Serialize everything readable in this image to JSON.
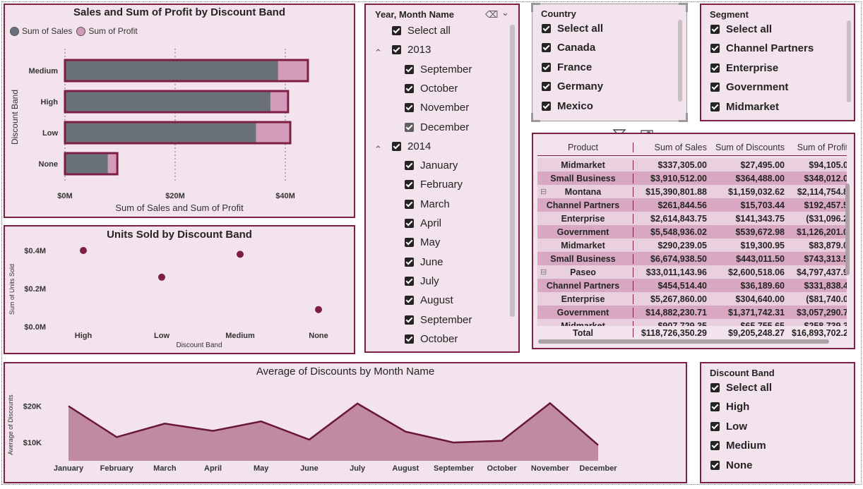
{
  "colors": {
    "accent": "#7d1f45",
    "panel_bg": "#f3e3ec",
    "sales_bar": "#6a717b",
    "profit_bar": "#d49ab9",
    "area_fill": "#bf8aa2",
    "row_band": "#d8a8c3"
  },
  "sales_profit_chart": {
    "title": "Sales and Sum of Profit by Discount Band",
    "legend": [
      {
        "label": "Sum of Sales",
        "color": "#6a717b"
      },
      {
        "label": "Sum of  Profit",
        "color": "#d49ab9"
      }
    ],
    "xlabel": "Sum of Sales and Sum of Profit",
    "ylabel": "Discount Band",
    "chart_data": {
      "type": "bar",
      "orientation": "horizontal",
      "stacked": true,
      "categories": [
        "Medium",
        "High",
        "Low",
        "None"
      ],
      "series": [
        {
          "name": "Sum of Sales",
          "values": [
            38.7,
            37.3,
            34.7,
            7.8
          ]
        },
        {
          "name": "Sum of  Profit",
          "values": [
            5.4,
            3.2,
            6.2,
            1.7
          ]
        }
      ],
      "xticks": [
        "$0M",
        "$20M",
        "$40M"
      ],
      "xtick_values": [
        0,
        20,
        40
      ],
      "xlim": [
        0,
        46
      ],
      "xlabel": "Sum of Sales and Sum of Profit",
      "ylabel": "Discount Band",
      "legend": "top-left"
    }
  },
  "units_chart": {
    "title": "Units Sold by Discount Band",
    "xlabel": "Discount Band",
    "ylabel": "Sum of Units Sold",
    "chart_data": {
      "type": "scatter",
      "categories": [
        "High",
        "Low",
        "Medium",
        "None"
      ],
      "values": [
        0.4,
        0.26,
        0.38,
        0.09
      ],
      "yticks": [
        "$0.0M",
        "$0.2M",
        "$0.4M"
      ],
      "ytick_values": [
        0,
        0.2,
        0.4
      ],
      "ylim": [
        0,
        0.4
      ]
    }
  },
  "year_month_slicer": {
    "title": "Year, Month Name",
    "items": [
      {
        "label": "Select all",
        "level": 0,
        "check": "on"
      },
      {
        "label": "2013",
        "level": 0,
        "check": "on",
        "expand": "⌃"
      },
      {
        "label": "September",
        "level": 1,
        "check": "on"
      },
      {
        "label": "October",
        "level": 1,
        "check": "on"
      },
      {
        "label": "November",
        "level": 1,
        "check": "on"
      },
      {
        "label": "December",
        "level": 1,
        "check": "partial"
      },
      {
        "label": "2014",
        "level": 0,
        "check": "on",
        "expand": "⌃"
      },
      {
        "label": "January",
        "level": 1,
        "check": "on"
      },
      {
        "label": "February",
        "level": 1,
        "check": "on"
      },
      {
        "label": "March",
        "level": 1,
        "check": "on"
      },
      {
        "label": "April",
        "level": 1,
        "check": "on"
      },
      {
        "label": "May",
        "level": 1,
        "check": "on"
      },
      {
        "label": "June",
        "level": 1,
        "check": "on"
      },
      {
        "label": "July",
        "level": 1,
        "check": "on"
      },
      {
        "label": "August",
        "level": 1,
        "check": "on"
      },
      {
        "label": "September",
        "level": 1,
        "check": "on"
      },
      {
        "label": "October",
        "level": 1,
        "check": "on"
      }
    ]
  },
  "country_slicer": {
    "title": "Country",
    "items": [
      "Select all",
      "Canada",
      "France",
      "Germany",
      "Mexico"
    ]
  },
  "segment_slicer": {
    "title": "Segment",
    "items": [
      "Select all",
      "Channel Partners",
      "Enterprise",
      "Government",
      "Midmarket"
    ]
  },
  "discount_slicer": {
    "title": "Discount Band",
    "items": [
      "Select all",
      "High",
      "Low",
      "Medium",
      "None"
    ]
  },
  "table": {
    "columns": [
      "Product",
      "Sum of Sales",
      "Sum of Discounts",
      "Sum of Profit"
    ],
    "rows": [
      {
        "label": "Midmarket",
        "sales": "$337,305.00",
        "discounts": "$27,495.00",
        "profit": "$94,105.0",
        "group": false,
        "band": false
      },
      {
        "label": "Small Business",
        "sales": "$3,910,512.00",
        "discounts": "$364,488.00",
        "profit": "$348,012.0",
        "group": false,
        "band": true
      },
      {
        "label": "Montana",
        "sales": "$15,390,801.88",
        "discounts": "$1,159,032.62",
        "profit": "$2,114,754.8",
        "group": true,
        "band": false
      },
      {
        "label": "Channel Partners",
        "sales": "$261,844.56",
        "discounts": "$15,703.44",
        "profit": "$192,457.5",
        "group": false,
        "band": true
      },
      {
        "label": "Enterprise",
        "sales": "$2,614,843.75",
        "discounts": "$141,343.75",
        "profit": "($31,096.2",
        "group": false,
        "band": false
      },
      {
        "label": "Government",
        "sales": "$5,548,936.02",
        "discounts": "$539,672.98",
        "profit": "$1,126,201.0",
        "group": false,
        "band": true
      },
      {
        "label": "Midmarket",
        "sales": "$290,239.05",
        "discounts": "$19,300.95",
        "profit": "$83,879.0",
        "group": false,
        "band": false
      },
      {
        "label": "Small Business",
        "sales": "$6,674,938.50",
        "discounts": "$443,011.50",
        "profit": "$743,313.5",
        "group": false,
        "band": true
      },
      {
        "label": "Paseo",
        "sales": "$33,011,143.96",
        "discounts": "$2,600,518.06",
        "profit": "$4,797,437.9",
        "group": true,
        "band": false
      },
      {
        "label": "Channel Partners",
        "sales": "$454,514.40",
        "discounts": "$36,189.60",
        "profit": "$331,838.4",
        "group": false,
        "band": true
      },
      {
        "label": "Enterprise",
        "sales": "$5,267,860.00",
        "discounts": "$304,640.00",
        "profit": "($81,740.0",
        "group": false,
        "band": false
      },
      {
        "label": "Government",
        "sales": "$14,882,230.71",
        "discounts": "$1,371,742.31",
        "profit": "$3,057,290.7",
        "group": false,
        "band": true
      },
      {
        "label": "Midmarket",
        "sales": "$907,729.35",
        "discounts": "$65,755.65",
        "profit": "$258,739.3",
        "group": false,
        "band": false
      }
    ],
    "total": {
      "label": "Total",
      "sales": "$118,726,350.29",
      "discounts": "$9,205,248.27",
      "profit": "$16,893,702.2"
    }
  },
  "area_chart": {
    "title": "Average of Discounts by Month Name",
    "ylabel": "Average of Discounts",
    "chart_data": {
      "type": "area",
      "categories": [
        "January",
        "February",
        "March",
        "April",
        "May",
        "June",
        "July",
        "August",
        "September",
        "October",
        "November",
        "December"
      ],
      "values": [
        20000,
        11500,
        15200,
        13200,
        15800,
        10800,
        20700,
        13000,
        10000,
        10500,
        20800,
        9300
      ],
      "yticks": [
        "$10K",
        "$20K"
      ],
      "ytick_values": [
        10000,
        20000
      ],
      "ylim": [
        5000,
        23000
      ]
    }
  }
}
